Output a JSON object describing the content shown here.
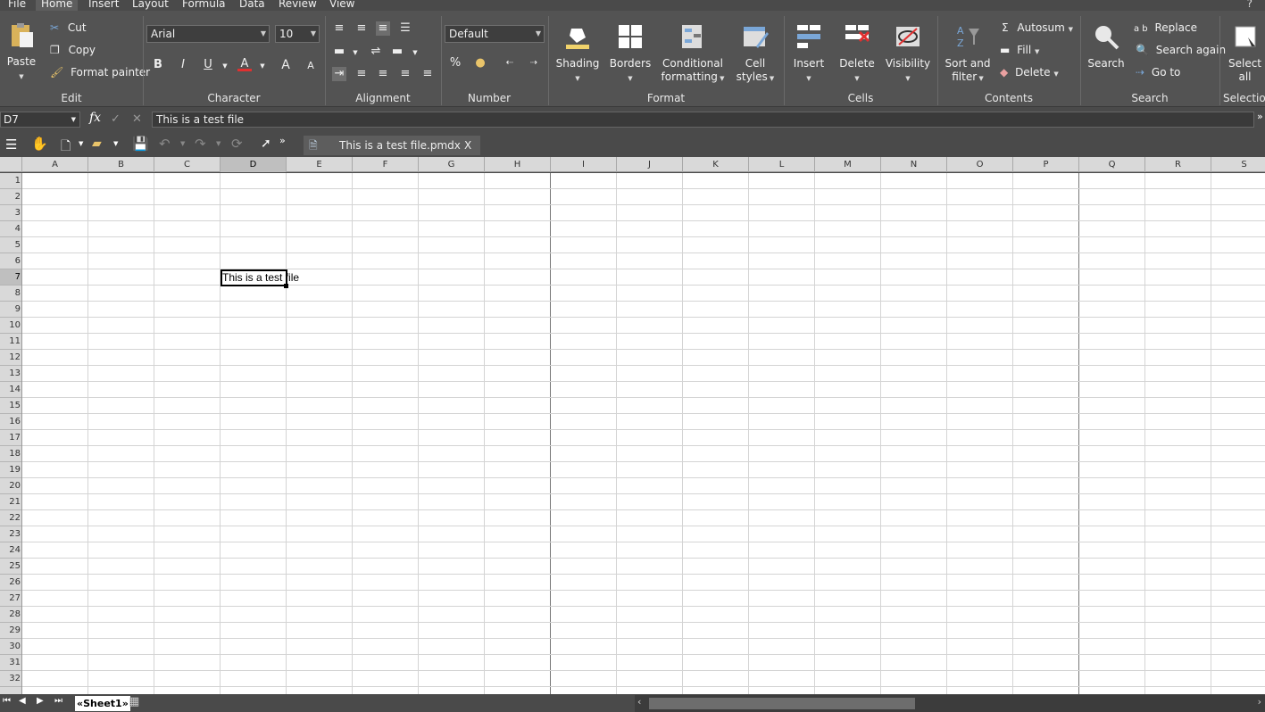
{
  "menu": {
    "items": [
      "File",
      "Home",
      "Insert",
      "Layout",
      "Formula",
      "Data",
      "Review",
      "View"
    ],
    "active": "Home",
    "help": "?"
  },
  "ribbon": {
    "edit": {
      "paste": "Paste",
      "cut": "Cut",
      "copy": "Copy",
      "format_painter": "Format painter",
      "label": "Edit"
    },
    "character": {
      "font": "Arial",
      "size": "10",
      "bold": "B",
      "italic": "I",
      "underline": "U",
      "font_color": "A",
      "grow": "A",
      "shrink": "A",
      "label": "Character"
    },
    "alignment": {
      "label": "Alignment"
    },
    "number": {
      "format": "Default",
      "percent": "%",
      "label": "Number"
    },
    "format": {
      "shading": "Shading",
      "borders": "Borders",
      "conditional1": "Conditional",
      "conditional2": "formatting",
      "cellstyles1": "Cell",
      "cellstyles2": "styles",
      "label": "Format"
    },
    "cells": {
      "insert": "Insert",
      "delete": "Delete",
      "visibility": "Visibility",
      "label": "Cells"
    },
    "contents": {
      "sort1": "Sort and",
      "sort2": "filter",
      "autosum": "Autosum",
      "fill": "Fill",
      "delete": "Delete",
      "label": "Contents"
    },
    "search": {
      "search": "Search",
      "replace": "Replace",
      "search_again": "Search again",
      "goto": "Go to",
      "label": "Search"
    },
    "selection": {
      "select1": "Select",
      "select2": "all",
      "label": "Selection"
    }
  },
  "formula_bar": {
    "cell_ref": "D7",
    "fx": "fx",
    "value": "This is a test file"
  },
  "document_tab": {
    "title": "This is a test file.pmdx",
    "close": "X"
  },
  "columns": [
    "A",
    "B",
    "C",
    "D",
    "E",
    "F",
    "G",
    "H",
    "I",
    "J",
    "K",
    "L",
    "M",
    "N",
    "O",
    "P",
    "Q",
    "R",
    "S"
  ],
  "selected_column": "D",
  "rows": [
    "1",
    "2",
    "3",
    "4",
    "5",
    "6",
    "7",
    "8",
    "9",
    "10",
    "11",
    "12",
    "13",
    "14",
    "15",
    "16",
    "17",
    "18",
    "19",
    "20",
    "21",
    "22",
    "23",
    "24",
    "25",
    "26",
    "27",
    "28",
    "29",
    "30",
    "31",
    "32"
  ],
  "selected_row": "7",
  "cell_D7": "This is a test file",
  "sheet_tab": "«Sheet1»",
  "colors": {
    "ribbon_bg": "#535353",
    "menubar_bg": "#4a4a4a",
    "header_bg": "#d9d9d9",
    "grid_line": "#d4d4d4",
    "font_red": "#e03030"
  }
}
